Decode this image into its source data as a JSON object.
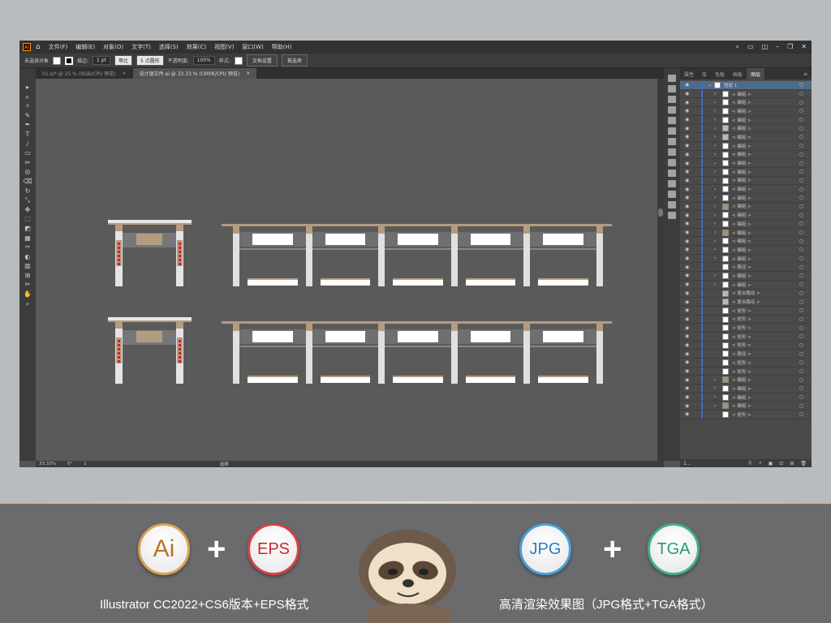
{
  "menu": {
    "logo": "Ai",
    "items": [
      "文件(F)",
      "编辑(E)",
      "对象(O)",
      "文字(T)",
      "选择(S)",
      "效果(C)",
      "视图(V)",
      "窗口(W)",
      "帮助(H)"
    ]
  },
  "control": {
    "selection": "未选择对象",
    "stroke_label": "描边:",
    "stroke_value": "1 pt",
    "stroke_profile": "等比",
    "brush": "5 点圆形",
    "opacity_label": "不透明度:",
    "opacity_value": "100%",
    "style_label": "样式:",
    "doc_setup": "文档设置",
    "prefs": "首选项"
  },
  "tabs": [
    {
      "label": "01.ai* @ 25 % (RGB/CPU 预览)",
      "active": false
    },
    {
      "label": "设计源文件.ai @ 33.33 % (CMYK/CPU 预览)",
      "active": true
    }
  ],
  "panel": {
    "tabs": [
      "属性",
      "库",
      "色板",
      "画板",
      "图层"
    ],
    "active_tab": "图层",
    "layer_count": "1...",
    "layers": [
      {
        "name": "图层 1",
        "top": true,
        "thumb": "white"
      },
      {
        "name": "< 编组 >",
        "arrow": true,
        "thumb": "white"
      },
      {
        "name": "< 编组 >",
        "arrow": true,
        "thumb": "white"
      },
      {
        "name": "< 编组 >",
        "arrow": true,
        "thumb": "white"
      },
      {
        "name": "< 编组 >",
        "arrow": true,
        "thumb": "white"
      },
      {
        "name": "< 编组 >",
        "arrow": true,
        "thumb": "pat"
      },
      {
        "name": "< 编组 >",
        "arrow": true,
        "thumb": "pat"
      },
      {
        "name": "< 编组 >",
        "arrow": true,
        "thumb": "white"
      },
      {
        "name": "< 编组 >",
        "arrow": true,
        "thumb": "white"
      },
      {
        "name": "< 编组 >",
        "arrow": true,
        "thumb": "white"
      },
      {
        "name": "< 编组 >",
        "arrow": true,
        "thumb": "white"
      },
      {
        "name": "< 编组 >",
        "arrow": true,
        "thumb": "white"
      },
      {
        "name": "< 编组 >",
        "arrow": true,
        "thumb": "white"
      },
      {
        "name": "< 编组 >",
        "arrow": true,
        "thumb": "white"
      },
      {
        "name": "< 编组 >",
        "arrow": true,
        "thumb": "brown"
      },
      {
        "name": "< 编组 >",
        "arrow": true,
        "thumb": "white"
      },
      {
        "name": "< 编组 >",
        "arrow": true,
        "thumb": "white"
      },
      {
        "name": "< 编组 >",
        "arrow": true,
        "thumb": "brown"
      },
      {
        "name": "< 编组 >",
        "arrow": true,
        "thumb": "white"
      },
      {
        "name": "< 编组 >",
        "arrow": true,
        "thumb": "white"
      },
      {
        "name": "< 编组 >",
        "arrow": true,
        "thumb": "white"
      },
      {
        "name": "< 路径 >",
        "arrow": false,
        "thumb": "white"
      },
      {
        "name": "< 编组 >",
        "arrow": true,
        "thumb": "white"
      },
      {
        "name": "< 编组 >",
        "arrow": true,
        "thumb": "white"
      },
      {
        "name": "< 复合路径 >",
        "arrow": false,
        "thumb": "pat"
      },
      {
        "name": "< 复合路径 >",
        "arrow": false,
        "thumb": "pat"
      },
      {
        "name": "< 矩形 >",
        "arrow": false,
        "thumb": "white"
      },
      {
        "name": "< 矩形 >",
        "arrow": false,
        "thumb": "white"
      },
      {
        "name": "< 矩形 >",
        "arrow": false,
        "thumb": "white"
      },
      {
        "name": "< 矩形 >",
        "arrow": false,
        "thumb": "white"
      },
      {
        "name": "< 矩形 >",
        "arrow": false,
        "thumb": "white"
      },
      {
        "name": "< 路径 >",
        "arrow": false,
        "thumb": "white"
      },
      {
        "name": "< 矩形 >",
        "arrow": false,
        "thumb": "white"
      },
      {
        "name": "< 矩形 >",
        "arrow": false,
        "thumb": "white"
      },
      {
        "name": "< 编组 >",
        "arrow": true,
        "thumb": "brown"
      },
      {
        "name": "< 编组 >",
        "arrow": true,
        "thumb": "white"
      },
      {
        "name": "< 编组 >",
        "arrow": true,
        "thumb": "white"
      },
      {
        "name": "< 编组 >",
        "arrow": true,
        "thumb": "brown"
      },
      {
        "name": "< 矩形 >",
        "arrow": false,
        "thumb": "white"
      }
    ]
  },
  "status": {
    "zoom": "33.33%",
    "rotation": "0°",
    "artboard": "1",
    "tool": "选择"
  },
  "banner": {
    "ai": "Ai",
    "eps": "EPS",
    "jpg": "JPG",
    "tga": "TGA",
    "plus": "+",
    "left_caption": "Illustrator CC2022+CS6版本+EPS格式",
    "right_caption": "高清渲染效果图（JPG格式+TGA格式）",
    "colors": {
      "ai": "#b8732a",
      "eps": "#c8282e",
      "jpg": "#2a7fc0",
      "tga": "#2a9a70"
    }
  },
  "colors": {
    "canvas": "#5a5a5a",
    "beam": "#b49c80",
    "selection": "#4f6b8a",
    "layer_bar": "#3b6fd1"
  }
}
